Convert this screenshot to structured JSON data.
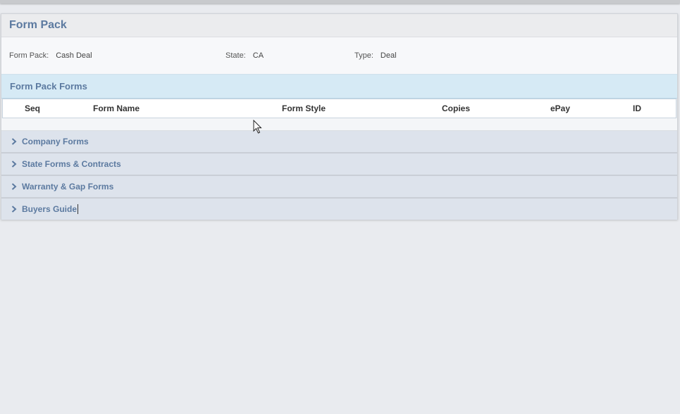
{
  "panel": {
    "title": "Form Pack",
    "info": {
      "form_pack_label": "Form Pack:",
      "form_pack_value": "Cash Deal",
      "state_label": "State:",
      "state_value": "CA",
      "type_label": "Type:",
      "type_value": "Deal"
    },
    "section_title": "Form Pack Forms",
    "columns": [
      "Seq",
      "Form Name",
      "Form Style",
      "Copies",
      "ePay",
      "ID"
    ],
    "groups": [
      {
        "label": "Company Forms",
        "icon": "chevron-right-icon"
      },
      {
        "label": "State Forms & Contracts",
        "icon": "chevron-right-icon"
      },
      {
        "label": "Warranty & Gap Forms",
        "icon": "chevron-right-icon"
      },
      {
        "label": "Buyers Guide",
        "icon": "chevron-right-icon"
      }
    ]
  },
  "colors": {
    "accent_text": "#5c7aa0",
    "section_bg": "#d6eaf5",
    "group_bg": "#dde3ec",
    "page_bg": "#e9ebef"
  }
}
